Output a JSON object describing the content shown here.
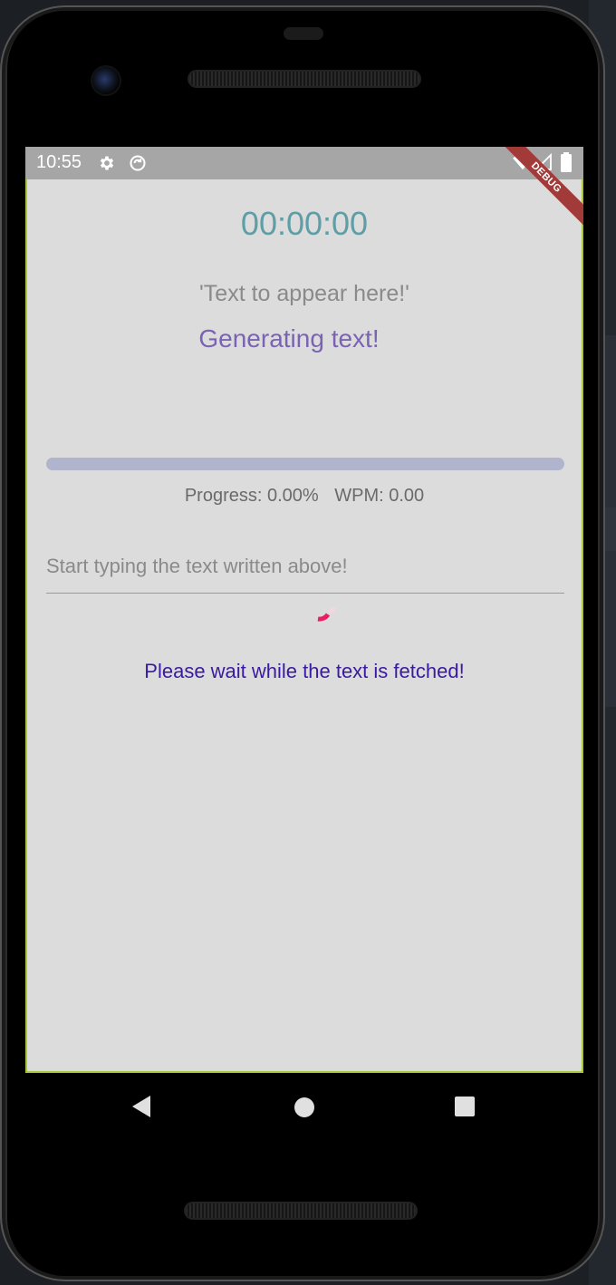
{
  "status_bar": {
    "time": "10:55",
    "icons": [
      "gear-icon",
      "sync-icon",
      "wifi-icon",
      "signal-icon",
      "battery-icon"
    ]
  },
  "debug_banner": "DEBUG",
  "app": {
    "timer": "00:00:00",
    "sample_text": "'Text to appear here!'",
    "generating_label": "Generating text!",
    "progress_fraction": 0.0,
    "progress_label": "Progress: 0.00%",
    "wpm_label": "WPM: 0.00",
    "input": {
      "value": "",
      "placeholder": "Start typing the text written above!"
    },
    "wait_message": "Please wait while the text is fetched!"
  },
  "nav": {
    "icons": [
      "back-icon",
      "home-icon",
      "recents-icon"
    ]
  },
  "colors": {
    "timer": "#5f9ea6",
    "generating": "#7a63b2",
    "wait_message": "#3a1aa0",
    "spinner": "#e91e63",
    "progress_track": "#b0b4cc",
    "app_background": "#dcdcdc",
    "status_bar": "#a6a6a6"
  }
}
